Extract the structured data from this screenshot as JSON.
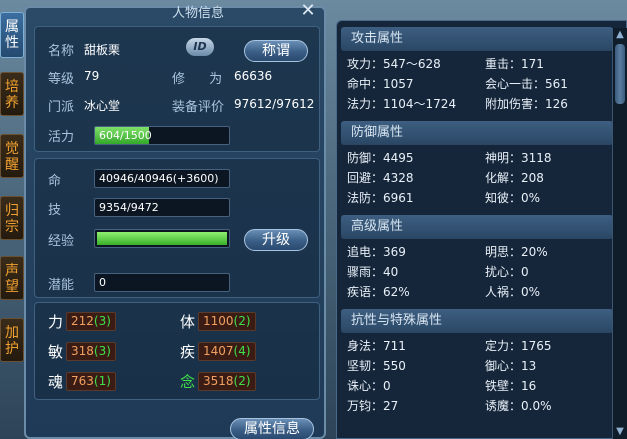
{
  "window": {
    "title": "人物信息"
  },
  "side_tabs": [
    {
      "label": "属性"
    },
    {
      "label": "培养"
    },
    {
      "label": "觉醒"
    },
    {
      "label": "归宗"
    },
    {
      "label": "声望"
    },
    {
      "label": "加护"
    }
  ],
  "profile": {
    "name_label": "名称",
    "name_value": "甜板栗",
    "id_badge": "ID",
    "title_button": "称谓",
    "level_label": "等级",
    "level_value": "79",
    "cultivation_label": "修 为",
    "cultivation_value": "66636",
    "sect_label": "门派",
    "sect_value": "冰心堂",
    "equip_label": "装备评价",
    "equip_value": "97612/97612",
    "vitality_label": "活力",
    "vitality_value": "604/1500",
    "vitality_ratio": 0.403
  },
  "stats": {
    "hp_label": "命",
    "hp_value": "40946/40946(+3600)",
    "skill_label": "技",
    "skill_value": "9354/9472",
    "exp_label": "经验",
    "exp_ratio": 1.0,
    "upgrade_button": "升级",
    "potential_label": "潜能",
    "potential_value": "0"
  },
  "attributes": [
    {
      "label": "力",
      "base": "212",
      "bonus": "(3)",
      "green": false
    },
    {
      "label": "体",
      "base": "1100",
      "bonus": "(2)",
      "green": false
    },
    {
      "label": "敏",
      "base": "318",
      "bonus": "(3)",
      "green": false
    },
    {
      "label": "疾",
      "base": "1407",
      "bonus": "(4)",
      "green": false
    },
    {
      "label": "魂",
      "base": "763",
      "bonus": "(1)",
      "green": false
    },
    {
      "label": "念",
      "base": "3518",
      "bonus": "(2)",
      "green": true
    }
  ],
  "footer": {
    "info_button": "属性信息"
  },
  "right_sections": [
    {
      "title": "攻击属性",
      "items": [
        "攻力：547～628",
        "重击：171",
        "命中：1057",
        "会心一击：561",
        "法力：1104～1724",
        "附加伤害：126"
      ]
    },
    {
      "title": "防御属性",
      "items": [
        "防御：4495",
        "神明：3118",
        "回避：4328",
        "化解：208",
        "法防：6961",
        "知彼：0%"
      ]
    },
    {
      "title": "高级属性",
      "items": [
        "追电：369",
        "明思：20%",
        "骤雨：40",
        "扰心：0",
        "疾语：62%",
        "人祸：0%"
      ]
    },
    {
      "title": "抗性与特殊属性",
      "items": [
        "身法：711",
        "定力：1765",
        "坚韧：550",
        "御心：13",
        "诛心：0",
        "铁壁：16",
        "万钧：27",
        "诱魔：0.0%"
      ]
    }
  ],
  "colors": {
    "accent_green": "#3fe04a",
    "attr_orange": "#f0a060",
    "tab_orange": "#f0a030"
  }
}
